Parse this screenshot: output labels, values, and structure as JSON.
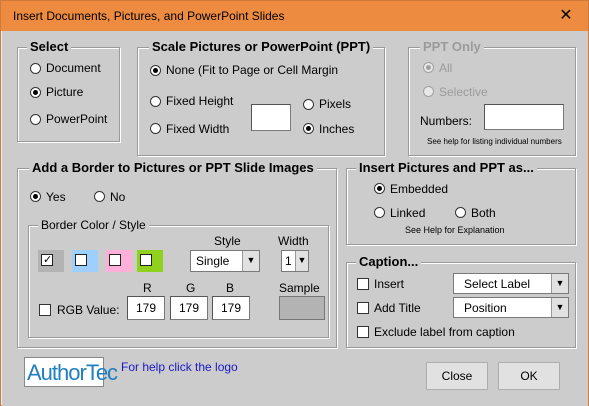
{
  "window": {
    "title": "Insert Documents, Pictures, and PowerPoint Slides",
    "close_glyph": "✕"
  },
  "select": {
    "title": "Select",
    "options": [
      "Document",
      "Picture",
      "PowerPoint"
    ],
    "selected": "Picture"
  },
  "scale": {
    "title": "Scale Pictures or PowerPoint (PPT)",
    "none_label": "None (Fit to Page or Cell Margin",
    "fixed_height_label": "Fixed Height",
    "fixed_width_label": "Fixed Width",
    "size_value": "",
    "pixels_label": "Pixels",
    "inches_label": "Inches",
    "selected_mode": "None (Fit to Page or Cell Margin",
    "selected_unit": "Inches"
  },
  "ppt_only": {
    "title": "PPT Only",
    "all_label": "All",
    "selective_label": "Selective",
    "numbers_label": "Numbers:",
    "numbers_value": "",
    "help_text": "See help for listing individual numbers"
  },
  "border": {
    "title": "Add a Border to Pictures or PPT Slide Images",
    "yes_label": "Yes",
    "no_label": "No",
    "selected": "Yes",
    "color_style_title": "Border Color / Style",
    "swatches": [
      {
        "color": "#b3b3b3",
        "checked": true,
        "mark": "✓"
      },
      {
        "color": "#9ed0ff",
        "checked": false,
        "mark": ""
      },
      {
        "color": "#ffb0d8",
        "checked": false,
        "mark": ""
      },
      {
        "color": "#8fd11c",
        "checked": false,
        "mark": ""
      }
    ],
    "style_label": "Style",
    "style_value": "Single",
    "width_label": "Width",
    "width_value": "1",
    "rgb_label": "RGB Value:",
    "r_label": "R",
    "g_label": "G",
    "b_label": "B",
    "r_value": "179",
    "g_value": "179",
    "b_value": "179",
    "sample_label": "Sample",
    "sample_color": "#b3b3b3"
  },
  "insert_as": {
    "title": "Insert Pictures and PPT as...",
    "embedded_label": "Embedded",
    "linked_label": "Linked",
    "both_label": "Both",
    "selected": "Embedded",
    "help_text": "See Help for Explanation"
  },
  "caption": {
    "title": "Caption...",
    "insert_label": "Insert",
    "insert_select": "Select Label",
    "add_title_label": "Add Title",
    "add_title_select": "Position",
    "exclude_label": "Exclude label from caption"
  },
  "footer": {
    "logo_text": "AuthorTec",
    "help_link": "For help click the logo",
    "close_label": "Close",
    "ok_label": "OK"
  }
}
